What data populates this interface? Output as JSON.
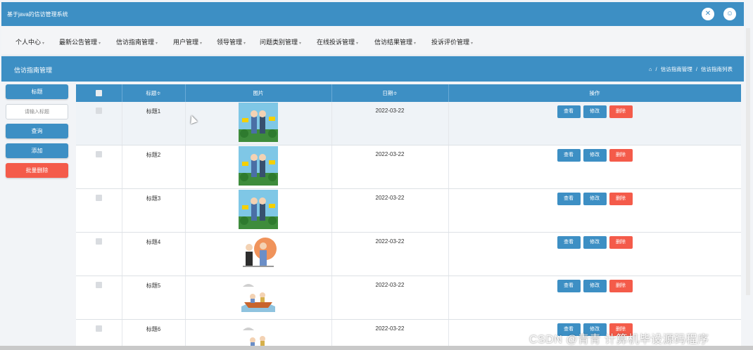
{
  "app": {
    "title": "基于java的信访管理系统"
  },
  "topbar_icons": [
    "close-icon",
    "user-icon"
  ],
  "menu": [
    "个人中心",
    "最新公告管理",
    "信访指南管理",
    "用户管理",
    "领导管理",
    "问题类别管理",
    "在线投诉管理",
    "信访结果管理",
    "投诉评价管理"
  ],
  "page_header": {
    "title": "信访指南管理",
    "breadcrumb": [
      "信访指南管理",
      "信访指南列表"
    ]
  },
  "sidebar": {
    "label": "标题",
    "search_placeholder": "请输入标题",
    "search_button": "查询",
    "add_button": "添加",
    "batch_delete_button": "批量删除"
  },
  "table": {
    "headers": [
      "标题≑",
      "图片",
      "日期≑",
      "操作"
    ],
    "actions": [
      "查看",
      "修改",
      "删除"
    ],
    "rows": [
      {
        "title": "标题1",
        "date": "2022-03-22",
        "image": "cartoon-students"
      },
      {
        "title": "标题2",
        "date": "2022-03-22",
        "image": "cartoon-students"
      },
      {
        "title": "标题3",
        "date": "2022-03-22",
        "image": "cartoon-students"
      },
      {
        "title": "标题4",
        "date": "2022-03-22",
        "image": "cartoon-teacher"
      },
      {
        "title": "标题5",
        "date": "2022-03-22",
        "image": "cartoon-boat"
      },
      {
        "title": "标题6",
        "date": "2022-03-22",
        "image": "cartoon-boat"
      }
    ]
  },
  "watermark": "CSDN @青青  计算机毕设源码程序",
  "colors": {
    "primary": "#3d8fc4",
    "danger": "#f45b4a",
    "row_highlight": "#eff3f7"
  }
}
